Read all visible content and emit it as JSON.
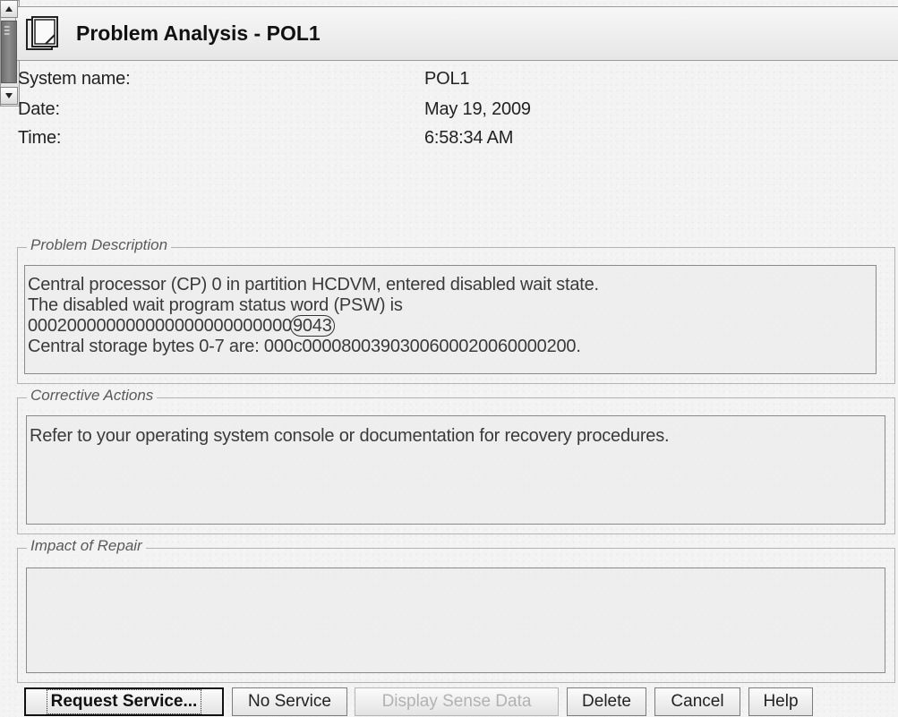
{
  "window": {
    "title": "Problem Analysis - POL1"
  },
  "info": {
    "system_name_label": "System name:",
    "system_name_value": "POL1",
    "date_label": "Date:",
    "date_value": "May 19, 2009",
    "time_label": "Time:",
    "time_value": "6:58:34 AM"
  },
  "problem_description": {
    "legend": "Problem Description",
    "lines": [
      "Central processor (CP) 0 in partition HCDVM, entered disabled wait state.",
      "The disabled wait program status word (PSW) is"
    ],
    "psw_prefix": "000200000000000000000000000",
    "psw_code": "9043",
    "storage_line": "Central storage bytes 0-7 are: 000c0000800390300600020060000200."
  },
  "corrective_actions": {
    "legend": "Corrective Actions",
    "text": "Refer to your operating system console or documentation for recovery procedures."
  },
  "impact_of_repair": {
    "legend": "Impact of Repair",
    "text": ""
  },
  "buttons": {
    "request_service": "Request Service...",
    "no_service": "No Service",
    "display_sense_data": "Display Sense Data",
    "delete": "Delete",
    "cancel": "Cancel",
    "help": "Help"
  },
  "icons": {
    "title": "document-icon",
    "scroll_up": "arrow-up-icon",
    "scroll_down": "arrow-down-icon"
  }
}
